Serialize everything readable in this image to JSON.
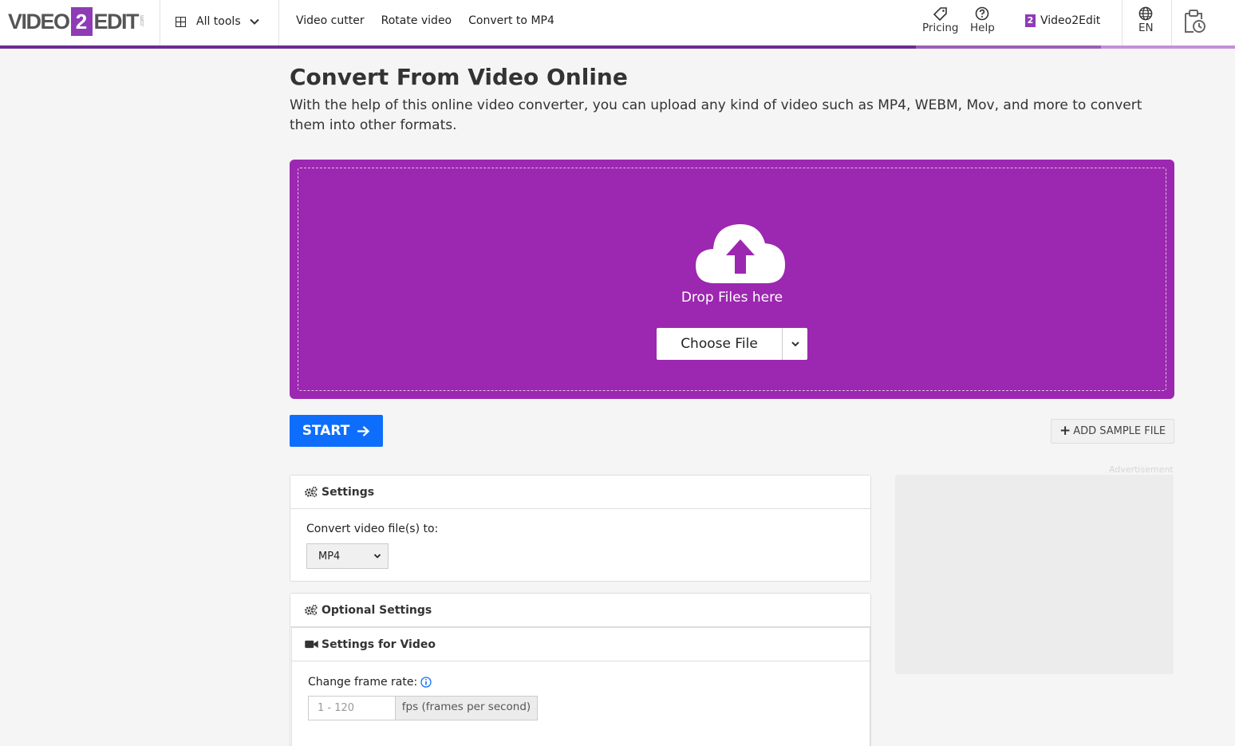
{
  "header": {
    "logo": {
      "left": "VIDEO",
      "mid": "2",
      "right": "EDIT",
      "suffix": ".com"
    },
    "all_tools": "All tools",
    "nav": [
      "Video cutter",
      "Rotate video",
      "Convert to MP4"
    ],
    "pricing": "Pricing",
    "help": "Help",
    "brand_link": "Video2Edit",
    "brand_badge": "2",
    "language": "EN"
  },
  "main": {
    "title": "Convert From Video Online",
    "subtitle": "With the help of this online video converter, you can upload any kind of video such as MP4, WEBM, Mov, and more to convert them into other formats.",
    "dropzone": {
      "drop_text": "Drop Files here",
      "choose_label": "Choose File"
    },
    "start_label": "START",
    "sample_label": "ADD SAMPLE FILE",
    "ad_label": "Advertisement"
  },
  "settings": {
    "header": "Settings",
    "convert_label": "Convert video file(s) to:",
    "format_value": "MP4"
  },
  "optional": {
    "header": "Optional Settings",
    "video_header": "Settings for Video",
    "frame_rate_label": "Change frame rate:",
    "frame_rate_placeholder": "1 - 120",
    "frame_rate_unit": "fps (frames per second)"
  },
  "colors": {
    "dropzone": "#9c27b0",
    "start": "#0d6efd",
    "brand": "#8e3bb6",
    "header_bar": "#6b2c91"
  }
}
